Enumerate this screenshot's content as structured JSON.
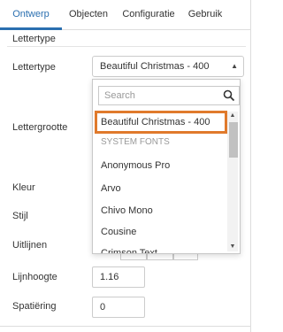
{
  "tabs": [
    {
      "label": "Ontwerp",
      "active": true
    },
    {
      "label": "Objecten",
      "active": false
    },
    {
      "label": "Configuratie",
      "active": false
    },
    {
      "label": "Gebruik",
      "active": false
    }
  ],
  "section": {
    "title": "Lettertype"
  },
  "fields": {
    "lettertype_label": "Lettertype",
    "lettertype_value": "Beautiful Christmas - 400",
    "lettergrootte_label": "Lettergrootte",
    "kleur_label": "Kleur",
    "stijl_label": "Stijl",
    "uitlijnen_label": "Uitlijnen",
    "lijnhoogte_label": "Lijnhoogte",
    "lijnhoogte_value": "1.16",
    "spatiering_label": "Spatiëring",
    "spatiering_value": "0"
  },
  "dropdown": {
    "search_placeholder": "Search",
    "options": [
      {
        "label": "Beautiful Christmas - 400",
        "kind": "selected"
      },
      {
        "label": "SYSTEM FONTS",
        "kind": "group"
      },
      {
        "label": "Anonymous Pro",
        "kind": "option"
      },
      {
        "label": "Arvo",
        "kind": "option"
      },
      {
        "label": "Chivo Mono",
        "kind": "option"
      },
      {
        "label": "Cousine",
        "kind": "option"
      },
      {
        "label": "Crimson Text",
        "kind": "option"
      }
    ]
  },
  "colors": {
    "accent": "#2a6fb0",
    "highlight": "#e07a2c",
    "muted": "#999999"
  },
  "icons": {
    "search": "search-icon",
    "select_caret": "sort-caret-icon",
    "scroll_up": "chevron-up-icon",
    "scroll_down": "chevron-down-icon"
  }
}
